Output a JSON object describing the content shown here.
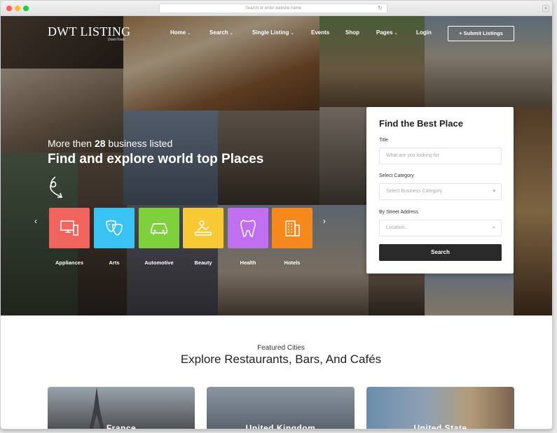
{
  "browser": {
    "url_placeholder": "Search or enter website name",
    "reload_icon": "reload-icon",
    "new_tab": "+"
  },
  "brand": {
    "name": "DWT LISTING",
    "sub": "DownTown"
  },
  "nav": {
    "items": [
      {
        "label": "Home",
        "caret": "⌄"
      },
      {
        "label": "Search",
        "caret": "⌄"
      },
      {
        "label": "Single Listing",
        "caret": "⌄"
      },
      {
        "label": "Events",
        "caret": ""
      },
      {
        "label": "Shop",
        "caret": ""
      },
      {
        "label": "Pages",
        "caret": "⌄"
      },
      {
        "label": "Login",
        "caret": ""
      }
    ],
    "submit_label": "+ Submit Listings"
  },
  "hero": {
    "tagline_prefix": "More then ",
    "tagline_count": "28",
    "tagline_suffix": " business listed",
    "headline": "Find and explore world top Places",
    "prev_arrow": "‹",
    "next_arrow": "›"
  },
  "categories": [
    {
      "label": "Appliances",
      "color": "#f0645d",
      "icon": "appliances-icon"
    },
    {
      "label": "Arts",
      "color": "#38c3f3",
      "icon": "theater-masks-icon"
    },
    {
      "label": "Automotive",
      "color": "#7ed03d",
      "icon": "car-icon"
    },
    {
      "label": "Beauty",
      "color": "#f7c935",
      "icon": "beauty-icon"
    },
    {
      "label": "Health",
      "color": "#c06ff0",
      "icon": "tooth-icon"
    },
    {
      "label": "Hotels",
      "color": "#f7891c",
      "icon": "building-icon"
    }
  ],
  "search_panel": {
    "title": "Find the Best Place",
    "title_label": "Title",
    "title_placeholder": "What are you looking for",
    "category_label": "Select Category",
    "category_value": "Select Business Category",
    "category_caret": "▾",
    "address_label": "By Street Address",
    "address_placeholder": "Location..",
    "locate_icon": "crosshair-icon",
    "search_label": "Search"
  },
  "featured": {
    "subtitle": "Featured Cities",
    "title": "Explore Restaurants, Bars, And Cafés",
    "cities": [
      {
        "name": "France"
      },
      {
        "name": "United Kingdom"
      },
      {
        "name": "United State"
      }
    ]
  }
}
